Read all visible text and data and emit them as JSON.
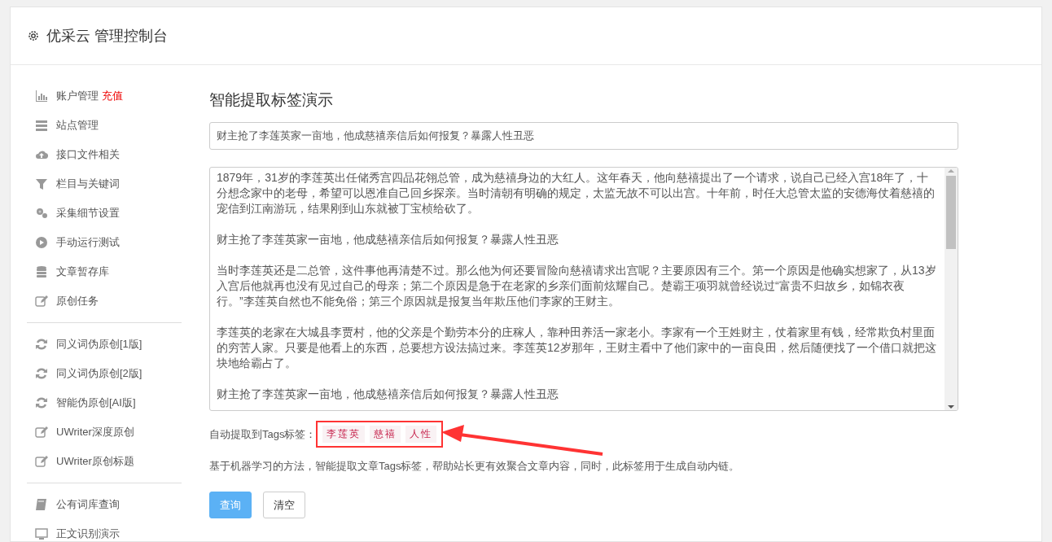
{
  "header": {
    "title": "优采云 管理控制台"
  },
  "sidebar": {
    "groups": [
      {
        "items": [
          {
            "label": "账户管理",
            "badge": "充值"
          },
          {
            "label": "站点管理"
          },
          {
            "label": "接口文件相关"
          },
          {
            "label": "栏目与关键词"
          },
          {
            "label": "采集细节设置"
          },
          {
            "label": "手动运行测试"
          },
          {
            "label": "文章暂存库"
          },
          {
            "label": "原创任务"
          }
        ]
      },
      {
        "items": [
          {
            "label": "同义词伪原创[1版]"
          },
          {
            "label": "同义词伪原创[2版]"
          },
          {
            "label": "智能伪原创[AI版]"
          },
          {
            "label": "UWriter深度原创"
          },
          {
            "label": "UWriter原创标题"
          }
        ]
      },
      {
        "items": [
          {
            "label": "公有词库查询"
          },
          {
            "label": "正文识别演示"
          }
        ]
      }
    ]
  },
  "main": {
    "heading": "智能提取标签演示",
    "title_field": {
      "value": "财主抢了李莲英家一亩地，他成慈禧亲信后如何报复？暴露人性丑恶"
    },
    "article": [
      "1879年，31岁的李莲英出任储秀宫四品花翎总管，成为慈禧身边的大红人。这年春天，他向慈禧提出了一个请求，说自己已经入宫18年了，十分想念家中的老母，希望可以恩准自己回乡探亲。当时清朝有明确的规定，太监无故不可以出宫。十年前，时任大总管太监的安德海仗着慈禧的宠信到江南游玩，结果刚到山东就被丁宝桢给砍了。",
      "财主抢了李莲英家一亩地，他成慈禧亲信后如何报复？暴露人性丑恶",
      "当时李莲英还是二总管，这件事他再清楚不过。那么他为何还要冒险向慈禧请求出宫呢？主要原因有三个。第一个原因是他确实想家了，从13岁入宫后他就再也没有见过自己的母亲；第二个原因是急于在老家的乡亲们面前炫耀自己。楚霸王项羽就曾经说过“富贵不归故乡，如锦衣夜行。”李莲英自然也不能免俗；第三个原因就是报复当年欺压他们李家的王财主。",
      "李莲英的老家在大城县李贾村，他的父亲是个勤劳本分的庄稼人，靠种田养活一家老小。李家有一个王姓财主，仗着家里有钱，经常欺负村里面的穷苦人家。只要是他看上的东西，总要想方设法搞过来。李莲英12岁那年，王财主看中了他们家中的一亩良田，然后随便找了一个借口就把这块地给霸占了。",
      "财主抢了李莲英家一亩地，他成慈禧亲信后如何报复？暴露人性丑恶"
    ],
    "tags_label": "自动提取到Tags标签：",
    "tags": [
      "李莲英",
      "慈禧",
      "人性"
    ],
    "note": "基于机器学习的方法，智能提取文章Tags标签，帮助站长更有效聚合文章内容，同时，此标签用于生成自动内链。",
    "buttons": [
      {
        "label": "查询",
        "kind": "primary"
      },
      {
        "label": "清空",
        "kind": "default"
      }
    ]
  }
}
